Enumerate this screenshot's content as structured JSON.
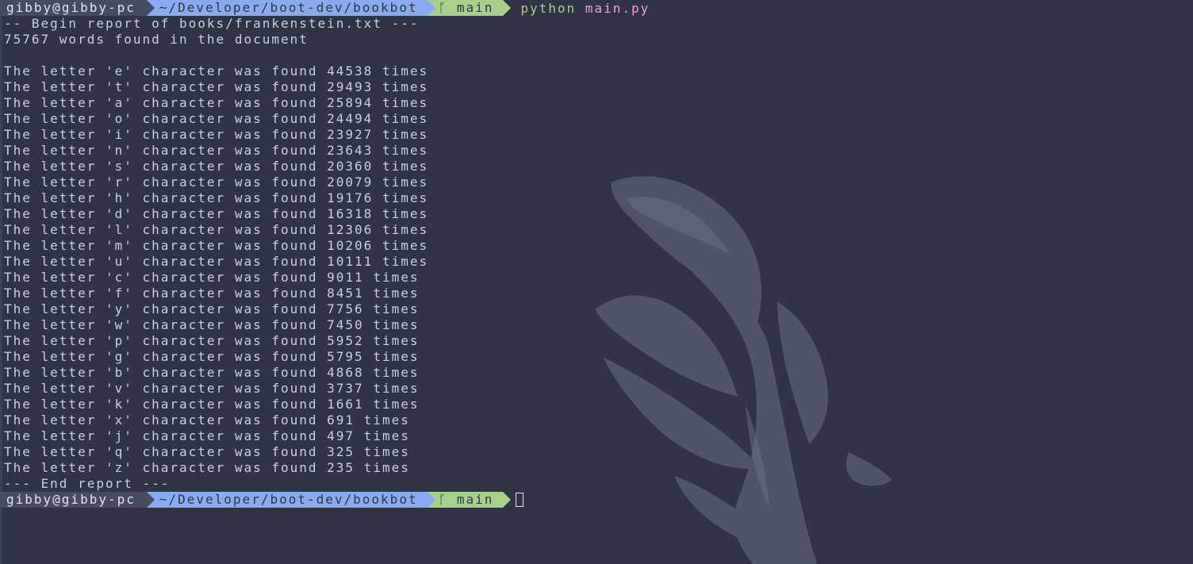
{
  "prompt": {
    "user": "gibby@gibby-pc",
    "path": "~/Developer/boot-dev/bookbot",
    "git_icon": "branch-icon",
    "git_glyph": "ᚴ",
    "branch": "main"
  },
  "command": {
    "program": "python",
    "argument": "main.py"
  },
  "output": {
    "header": "-- Begin report of books/frankenstein.txt ---",
    "word_count": "75767 words found in the document",
    "letters": [
      "The letter 'e' character was found 44538 times",
      "The letter 't' character was found 29493 times",
      "The letter 'a' character was found 25894 times",
      "The letter 'o' character was found 24494 times",
      "The letter 'i' character was found 23927 times",
      "The letter 'n' character was found 23643 times",
      "The letter 's' character was found 20360 times",
      "The letter 'r' character was found 20079 times",
      "The letter 'h' character was found 19176 times",
      "The letter 'd' character was found 16318 times",
      "The letter 'l' character was found 12306 times",
      "The letter 'm' character was found 10206 times",
      "The letter 'u' character was found 10111 times",
      "The letter 'c' character was found 9011 times",
      "The letter 'f' character was found 8451 times",
      "The letter 'y' character was found 7756 times",
      "The letter 'w' character was found 7450 times",
      "The letter 'p' character was found 5952 times",
      "The letter 'g' character was found 5795 times",
      "The letter 'b' character was found 4868 times",
      "The letter 'v' character was found 3737 times",
      "The letter 'k' character was found 1661 times",
      "The letter 'x' character was found 691 times",
      "The letter 'j' character was found 497 times",
      "The letter 'q' character was found 325 times",
      "The letter 'z' character was found 235 times"
    ],
    "footer": "--- End report ---"
  },
  "colors": {
    "background": "#303445",
    "user_segment": "#464c62",
    "path_segment": "#8aaaf0",
    "git_segment": "#a8d08a",
    "command_program": "#a8d08a",
    "command_argument": "#f0a0d8",
    "text": "#c8cee4"
  },
  "wallpaper": {
    "icon": "betta-fish-wallpaper"
  }
}
